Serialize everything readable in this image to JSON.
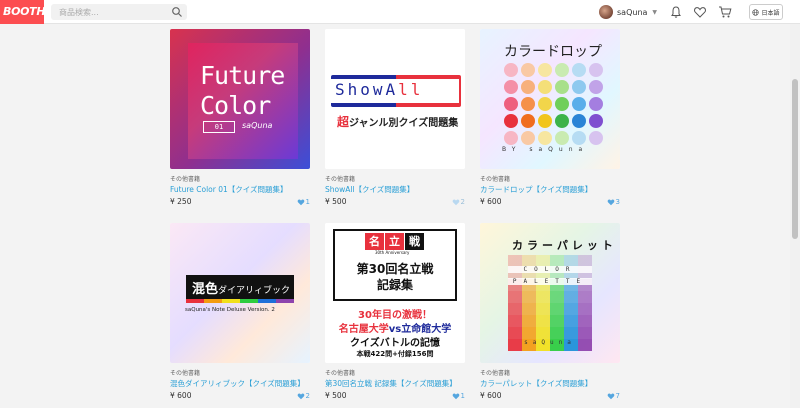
{
  "header": {
    "logo_text": "BOOTH",
    "logo_suffix": "π",
    "search_placeholder": "商品検索...",
    "username": "saQuna",
    "lang_label": "日本語",
    "icons": [
      "search-icon",
      "bell-icon",
      "heart-icon",
      "cart-icon",
      "globe-icon"
    ]
  },
  "products": [
    {
      "category": "その他書籍",
      "title": "Future Color 01【クイズ問題集】",
      "price": "¥ 250",
      "likes": "1",
      "cover": {
        "line1": "Future",
        "line2": "Color",
        "number": "01",
        "sig": "saQuna"
      }
    },
    {
      "category": "その他書籍",
      "title": "ShowAll【クイズ問題集】",
      "price": "¥ 500",
      "likes": "2",
      "cover": {
        "logo_a": "ShowA",
        "logo_b": "ll",
        "sub_red": "超",
        "sub": "ジャンル別クイズ問題集"
      }
    },
    {
      "category": "その他書籍",
      "title": "カラードロップ【クイズ問題集】",
      "price": "¥ 600",
      "likes": "3",
      "cover": {
        "title": "カラードロップ",
        "sig": "BY saQuna"
      }
    },
    {
      "category": "その他書籍",
      "title": "混色ダイアリィブック【クイズ問題集】",
      "price": "¥ 600",
      "likes": "2",
      "cover": {
        "big": "混色",
        "small": "ダイアリィブック",
        "caption": "saQuna's Note Deluxe Version. 2"
      }
    },
    {
      "category": "その他書籍",
      "title": "第30回名立戦 記録集【クイズ問題集】",
      "price": "¥ 500",
      "likes": "1",
      "cover": {
        "logo": [
          "名",
          "立",
          "戦"
        ],
        "anniv": "30th Anniversary",
        "title1": "第30回名立戦",
        "title2": "記録集",
        "line1": "30年目の激戦！",
        "line2a": "名古屋大学",
        "line2b": "vs",
        "line2c": "立命館大学",
        "line3": "クイズバトルの記憶",
        "line4": "本戦422問+付録156問"
      }
    },
    {
      "category": "その他書籍",
      "title": "カラーパレット【クイズ問題集】",
      "price": "¥ 600",
      "likes": "7",
      "cover": {
        "title": "カラーパレット",
        "row1": "COLOR",
        "row2": "PALETTE",
        "sig": "saQuna"
      }
    }
  ],
  "colors": {
    "brand": "#fc4d50",
    "link": "#2a9fd6",
    "like": "#55a6df"
  }
}
